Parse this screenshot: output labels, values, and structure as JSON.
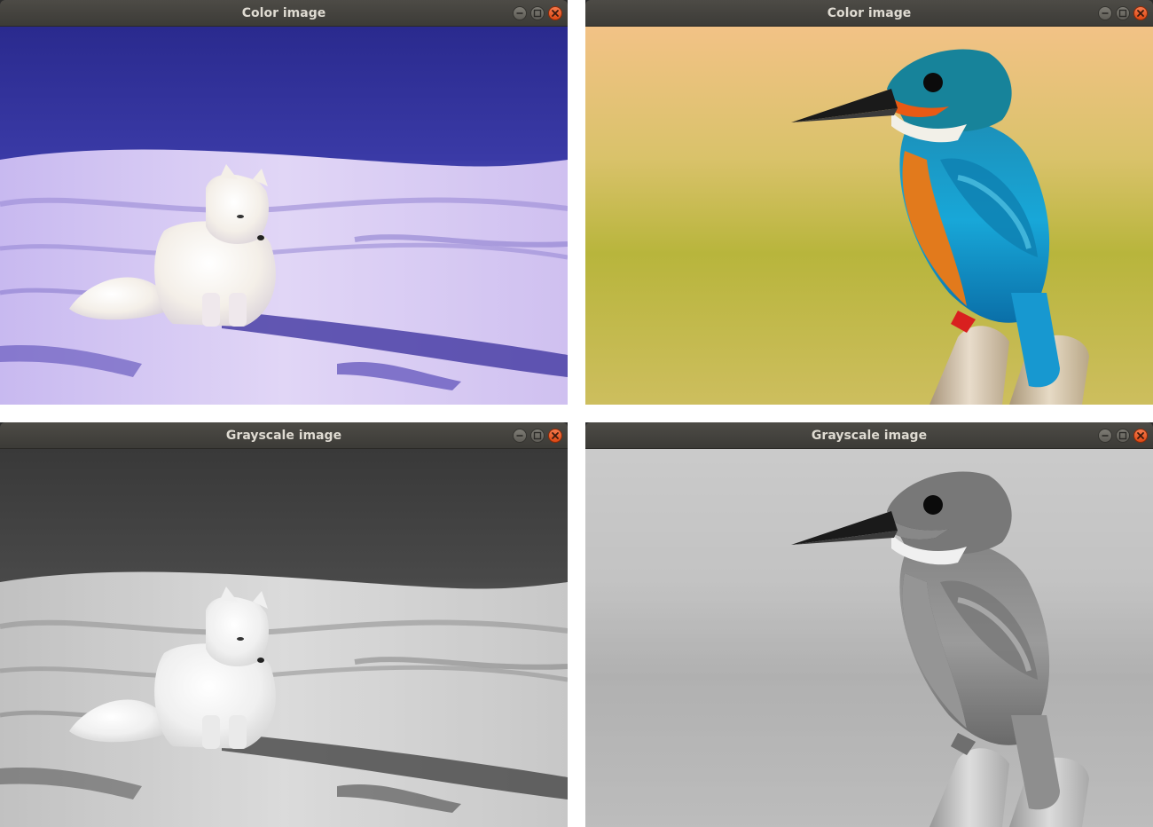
{
  "windows": [
    {
      "title": "Color image",
      "image": "arctic-fox-photo"
    },
    {
      "title": "Color image",
      "image": "kingfisher-photo"
    },
    {
      "title": "Grayscale image",
      "image": "arctic-fox-photo-grayscale"
    },
    {
      "title": "Grayscale image",
      "image": "kingfisher-photo-grayscale"
    }
  ],
  "icons": {
    "minimize": "minimize-icon",
    "maximize": "maximize-icon",
    "close": "close-icon"
  },
  "colors": {
    "titlebar": "#3c3b37",
    "title_text": "#dfdbd2",
    "close_button": "#dd4814"
  }
}
